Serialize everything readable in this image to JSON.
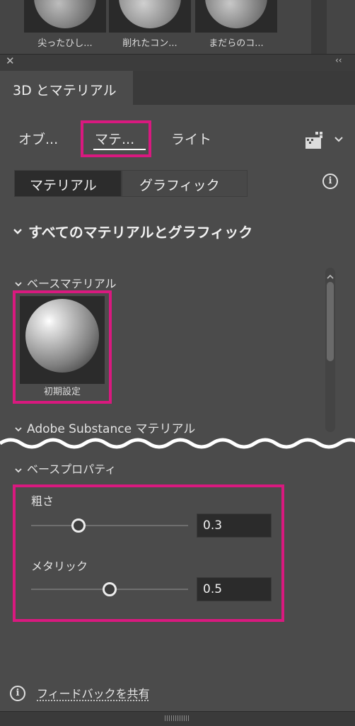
{
  "presets": [
    {
      "label": "尖ったひし..."
    },
    {
      "label": "削れたコン..."
    },
    {
      "label": "まだらのコ..."
    }
  ],
  "panel": {
    "close_icon": "close-icon",
    "collapse_icon": "double-chevron-icon",
    "tab_title": "3D とマテリアル"
  },
  "subtabs": {
    "object": "オブ...",
    "material": "マテ...",
    "light": "ライト",
    "render_icon": "render-icon"
  },
  "segments": {
    "material": "マテリアル",
    "graphic": "グラフィック"
  },
  "section": {
    "all_title": "すべてのマテリアルとグラフィック",
    "base_material": "ベースマテリアル",
    "default_material": "初期設定",
    "adobe_substance": "Adobe Substance マテリアル",
    "base_properties": "ベースプロパティ"
  },
  "properties": {
    "roughness_label": "粗さ",
    "roughness_value": "0.3",
    "roughness_level": 0.3,
    "metallic_label": "メタリック",
    "metallic_value": "0.5",
    "metallic_level": 0.5
  },
  "footer": {
    "feedback": "フィードバックを共有"
  },
  "colors": {
    "highlight": "#d9197f",
    "panel_bg": "#4b4b4b"
  }
}
